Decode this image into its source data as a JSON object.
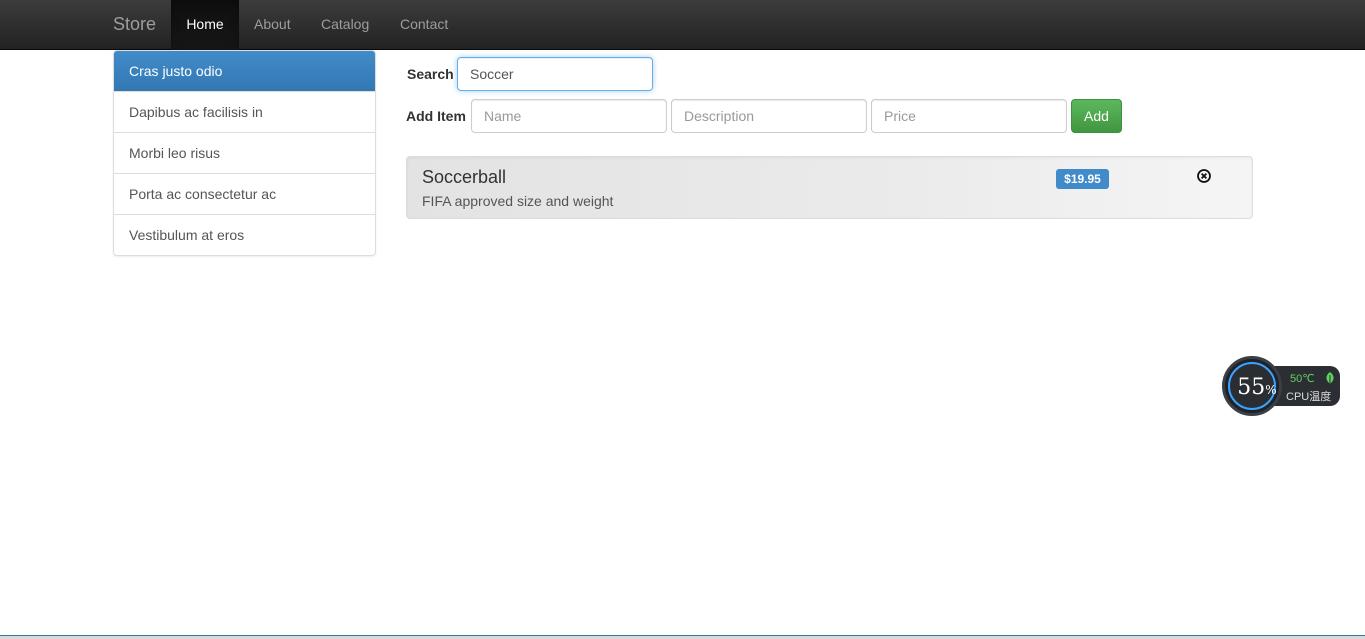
{
  "navbar": {
    "brand": "Store",
    "items": [
      {
        "label": "Home",
        "active": true
      },
      {
        "label": "About",
        "active": false
      },
      {
        "label": "Catalog",
        "active": false
      },
      {
        "label": "Contact",
        "active": false
      }
    ]
  },
  "sidebar": {
    "items": [
      {
        "label": "Cras justo odio",
        "active": true
      },
      {
        "label": "Dapibus ac facilisis in",
        "active": false
      },
      {
        "label": "Morbi leo risus",
        "active": false
      },
      {
        "label": "Porta ac consectetur ac",
        "active": false
      },
      {
        "label": "Vestibulum at eros",
        "active": false
      }
    ]
  },
  "search": {
    "label": "Search",
    "value": "Soccer"
  },
  "add_item": {
    "label": "Add Item",
    "name_placeholder": "Name",
    "description_placeholder": "Description",
    "price_placeholder": "Price",
    "button_label": "Add"
  },
  "items": [
    {
      "name": "Soccerball",
      "description": "FIFA approved size and weight",
      "price": "$19.95",
      "remove_icon": "remove-circle-icon"
    }
  ],
  "cpu_widget": {
    "percent": "55",
    "percent_unit": "%",
    "temperature": "50℃",
    "label": "CPU温度",
    "icon": "leaf-icon"
  },
  "colors": {
    "navbar": "#222222",
    "primary": "#428bca",
    "success": "#5cb85c",
    "cpu_green": "#5fd35f",
    "cpu_ring": "#3aa3ff"
  }
}
